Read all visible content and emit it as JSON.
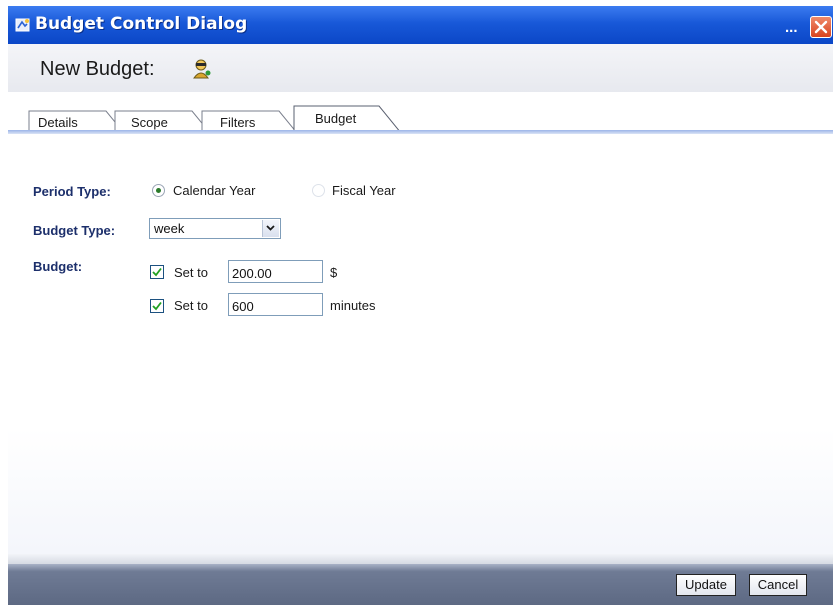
{
  "window": {
    "title": "Budget Control Dialog",
    "overflow": "..."
  },
  "header": {
    "title": "New Budget:"
  },
  "tabs": [
    {
      "label": "Details"
    },
    {
      "label": "Scope"
    },
    {
      "label": "Filters"
    },
    {
      "label": "Budget",
      "active": true
    }
  ],
  "form": {
    "period_type": {
      "label": "Period Type:",
      "options": [
        "Calendar Year",
        "Fiscal Year"
      ],
      "selected": "Calendar Year"
    },
    "budget_type": {
      "label": "Budget Type:",
      "value": "week"
    },
    "budget": {
      "label": "Budget:",
      "rows": [
        {
          "checked": true,
          "label": "Set to",
          "value": "200.00",
          "unit": "$"
        },
        {
          "checked": true,
          "label": "Set to",
          "value": "600",
          "unit": "minutes"
        }
      ]
    }
  },
  "footer": {
    "update_label": "Update",
    "cancel_label": "Cancel"
  },
  "colors": {
    "titlebar": "#1858d8",
    "label": "#1c2f6b",
    "footer": "#5d6983"
  }
}
